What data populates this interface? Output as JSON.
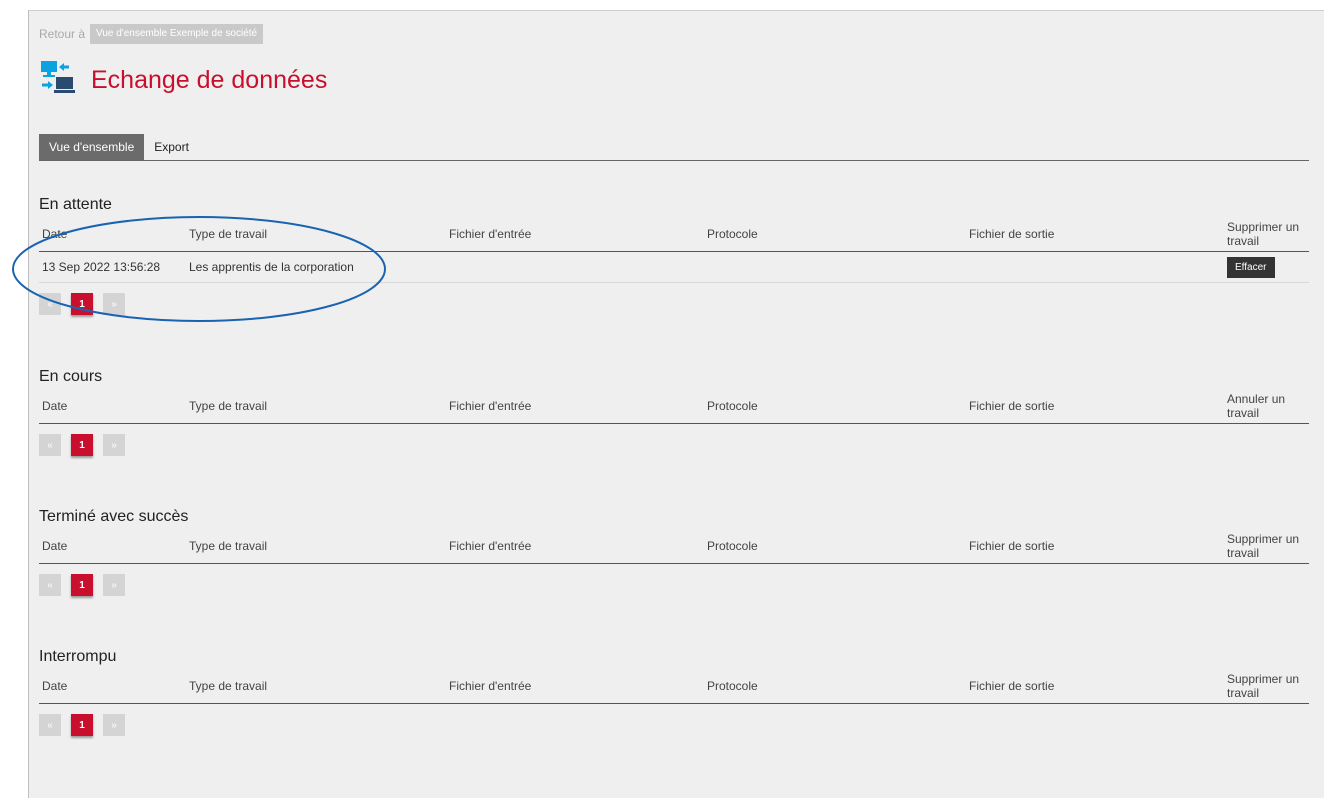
{
  "breadcrumb": {
    "prefix": "Retour à",
    "link": "Vue d'ensemble Exemple de société"
  },
  "page": {
    "title": "Echange de données",
    "icon": "data-exchange-icon"
  },
  "tabs": [
    {
      "label": "Vue d'ensemble",
      "active": true
    },
    {
      "label": "Export",
      "active": false
    }
  ],
  "columns": {
    "date": "Date",
    "type": "Type de travail",
    "input": "Fichier d'entrée",
    "protocol": "Protocole",
    "output": "Fichier de sortie"
  },
  "sections": {
    "pending": {
      "title": "En attente",
      "action_header": "Supprimer un travail",
      "rows": [
        {
          "date": "13 Sep 2022 13:56:28",
          "type": "Les apprentis de la corporation",
          "input": "",
          "protocol": "",
          "output": "",
          "action": "Effacer"
        }
      ],
      "pager": {
        "prev": "«",
        "page": "1",
        "next": "»"
      }
    },
    "running": {
      "title": "En cours",
      "action_header": "Annuler un travail",
      "pager": {
        "prev": "«",
        "page": "1",
        "next": "»"
      }
    },
    "success": {
      "title": "Terminé avec succès",
      "action_header": "Supprimer un travail",
      "pager": {
        "prev": "«",
        "page": "1",
        "next": "»"
      }
    },
    "interrupted": {
      "title": "Interrompu",
      "action_header": "Supprimer un travail",
      "pager": {
        "prev": "«",
        "page": "1",
        "next": "»"
      }
    }
  },
  "colors": {
    "accent": "#c8102e",
    "icon_blue": "#0aa3e0",
    "icon_dark": "#2b4a6f",
    "annotation": "#1a63b0"
  }
}
